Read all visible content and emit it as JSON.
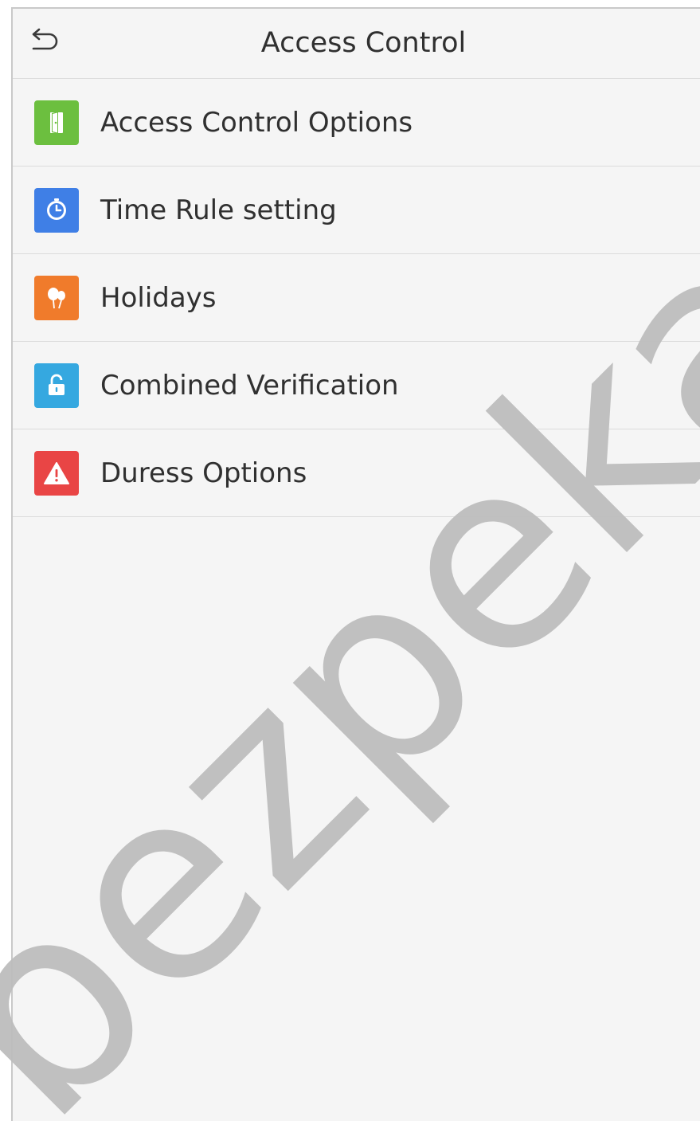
{
  "header": {
    "title": "Access Control",
    "back_icon": "back-arrow-icon"
  },
  "menu": {
    "items": [
      {
        "label": "Access Control Options",
        "icon": "door-icon",
        "color": "#6cbf3f"
      },
      {
        "label": "Time Rule setting",
        "icon": "clock-icon",
        "color": "#3f7fe6"
      },
      {
        "label": "Holidays",
        "icon": "balloons-icon",
        "color": "#f07b2b"
      },
      {
        "label": "Combined Verification",
        "icon": "unlock-icon",
        "color": "#35a8e0"
      },
      {
        "label": "Duress Options",
        "icon": "warning-icon",
        "color": "#e94545"
      }
    ]
  },
  "watermark": {
    "text": "bezpeka-shop",
    "color": "#b9b9b9"
  }
}
